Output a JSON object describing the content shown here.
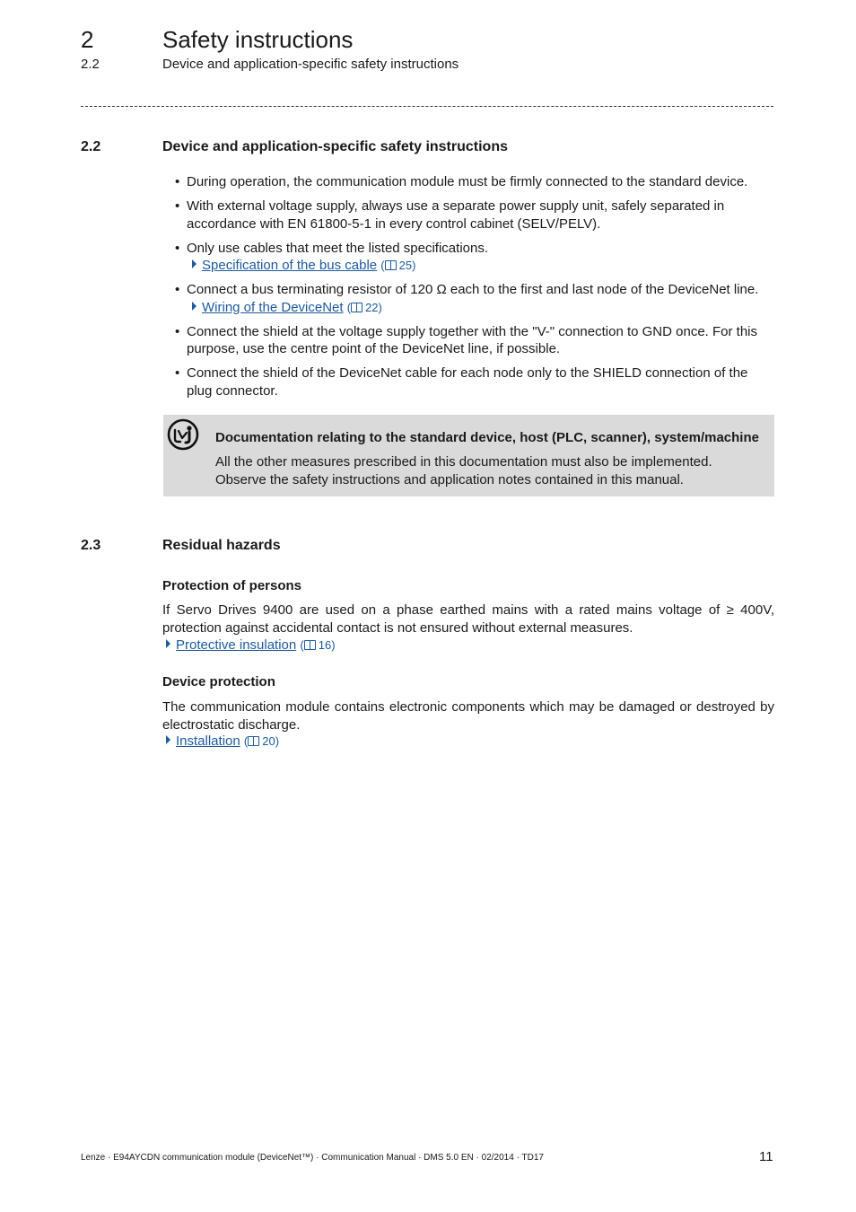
{
  "header": {
    "chapter_number": "2",
    "chapter_title": "Safety instructions",
    "section_number": "2.2",
    "section_title": "Device and application-specific safety instructions"
  },
  "section_2_2": {
    "number": "2.2",
    "title": "Device and application-specific safety instructions",
    "bullets": [
      {
        "text": "During operation, the communication module must be firmly connected to the standard device."
      },
      {
        "text": "With external voltage supply, always use a separate power supply unit, safely separated in accordance with EN 61800-5-1 in every control cabinet (SELV/PELV)."
      },
      {
        "text": "Only use cables that meet the listed specifications.",
        "link": {
          "label": "Specification of the bus cable",
          "page": "25"
        }
      },
      {
        "text": "Connect a bus terminating resistor of 120 Ω each to the first and last node of the DeviceNet line.",
        "link": {
          "label": "Wiring of the DeviceNet",
          "page": "22"
        }
      },
      {
        "text": "Connect the shield at the voltage supply together with the \"V-\" connection to GND once. For this purpose, use the centre point of the DeviceNet line, if possible."
      },
      {
        "text": "Connect the shield of the DeviceNet cable for each node only to the SHIELD connection of the plug connector."
      }
    ],
    "note": {
      "icon": "documentation-icon",
      "title": "Documentation relating to the standard device, host (PLC, scanner), system/machine",
      "lines": [
        "All the other measures prescribed in this documentation must also be implemented.",
        "Observe the safety instructions and application notes contained in this manual."
      ]
    }
  },
  "section_2_3": {
    "number": "2.3",
    "title": "Residual hazards",
    "persons": {
      "heading": "Protection of persons",
      "text": "If Servo Drives 9400 are used on a phase earthed mains with a rated mains voltage of ≥ 400V, protection against accidental contact is not ensured without external measures.",
      "link": {
        "label": "Protective insulation",
        "page": "16"
      }
    },
    "device": {
      "heading": "Device protection",
      "text": "The communication module contains electronic components which may be damaged or destroyed by electrostatic discharge.",
      "link": {
        "label": "Installation",
        "page": "20"
      }
    }
  },
  "footer": {
    "text": "Lenze · E94AYCDN communication module (DeviceNet™) · Communication Manual · DMS 5.0 EN · 02/2014 · TD17",
    "page_number": "11"
  },
  "colors": {
    "link": "#1d5a9e",
    "note_background": "#dadada"
  }
}
